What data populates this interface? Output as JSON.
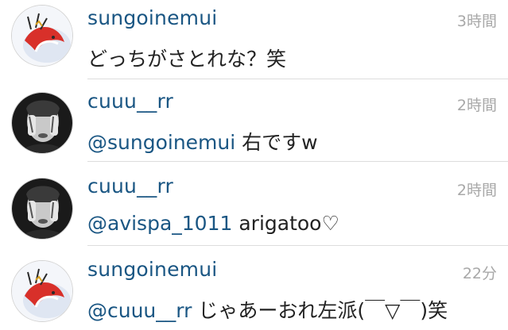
{
  "comments": [
    {
      "username": "sungoinemui",
      "time": "3時間",
      "mention": "",
      "text": "どっちがさとれな？笑",
      "avatar_icon": "bird-doodle-avatar"
    },
    {
      "username": "cuuu__rr",
      "time": "2時間",
      "mention": "@sungoinemui",
      "text": " 右ですw",
      "avatar_icon": "bw-photo-avatar"
    },
    {
      "username": "cuuu__rr",
      "time": "2時間",
      "mention": "@avispa_1011",
      "text": " arigatoo♡",
      "avatar_icon": "bw-photo-avatar"
    },
    {
      "username": "sungoinemui",
      "time": "22分",
      "mention": "@cuuu__rr",
      "text": " じゃあーおれ左派(￣▽￣)笑",
      "avatar_icon": "bird-doodle-avatar"
    }
  ],
  "colors": {
    "username": "#1a5683",
    "mention": "#1a5683",
    "time": "#a8a8a8",
    "text": "#222222",
    "divider": "#dddddd"
  }
}
